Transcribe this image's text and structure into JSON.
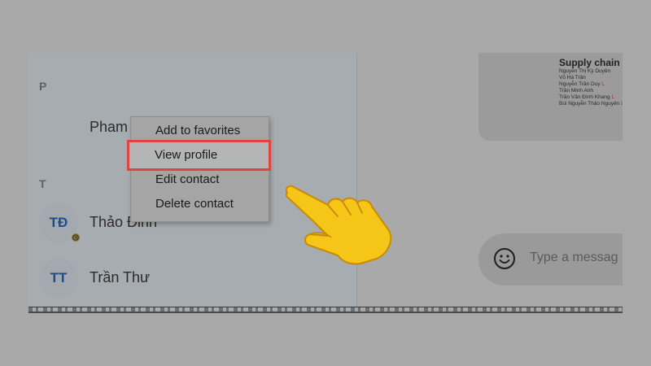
{
  "contacts": {
    "sections": [
      {
        "letter": "P"
      },
      {
        "letter": "T"
      }
    ],
    "items": [
      {
        "name": "Pham",
        "initials": ""
      },
      {
        "name": "Thảo Đinh",
        "initials": "TĐ"
      },
      {
        "name": "Trần Thư",
        "initials": "TT"
      }
    ]
  },
  "context_menu": {
    "items": [
      {
        "label": "Add to favorites"
      },
      {
        "label": "View profile"
      },
      {
        "label": "Edit contact"
      },
      {
        "label": "Delete contact"
      }
    ],
    "highlighted_index": 1
  },
  "chat": {
    "preview": {
      "title": "Supply chain",
      "lines": [
        "Nguyễn Thị Kỳ Duyên",
        "Võ Hà Trân",
        "Nguyễn Trần Duy",
        "Trần Minh Anh",
        "Trần Văn Đình Khang",
        "Bùi Nguyễn Thảo Nguyên"
      ],
      "marks": [
        "",
        "",
        "L",
        "",
        "L",
        "L"
      ]
    },
    "composer": {
      "placeholder": "Type a messag"
    }
  },
  "icons": {
    "emoji": "emoji-icon",
    "status": "clock-icon",
    "pointer": "pointing-hand-icon"
  },
  "colors": {
    "highlight_border": "#e04343",
    "hand_fill": "#f5c518"
  }
}
